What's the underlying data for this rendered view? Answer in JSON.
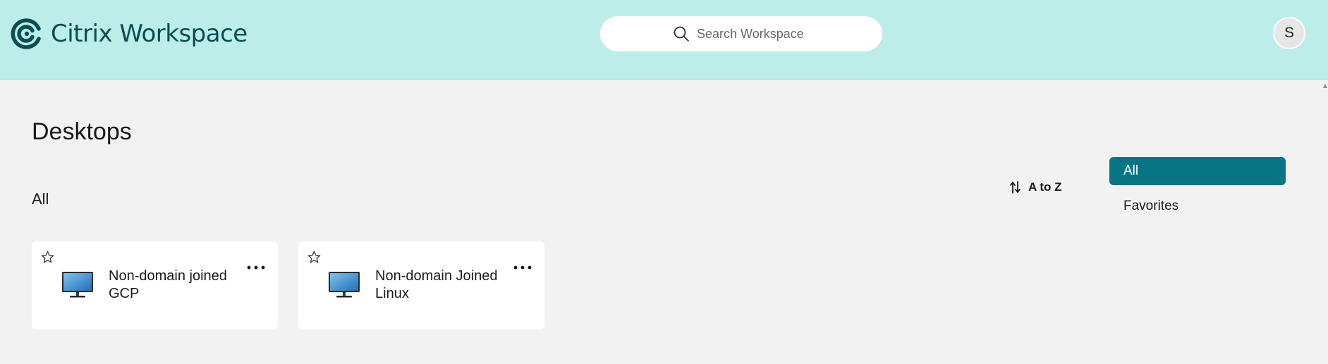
{
  "header": {
    "logo_text": "Citrix Workspace",
    "search": {
      "placeholder": "Search Workspace",
      "value": ""
    },
    "avatar_initial": "S",
    "background_color": "#bcede9",
    "brand_color": "#0a4d52"
  },
  "page": {
    "title": "Desktops",
    "section_label": "All",
    "sort_label": "A to Z",
    "sort_icon": "sort-arrows-icon",
    "accent_color": "#077584"
  },
  "filters": [
    {
      "label": "All",
      "active": true
    },
    {
      "label": "Favorites",
      "active": false
    }
  ],
  "desktops": [
    {
      "name": "Non-domain joined GCP",
      "icon": "desktop-monitor-icon",
      "favorite": false
    },
    {
      "name": "Non-domain Joined Linux",
      "icon": "desktop-monitor-icon",
      "favorite": false
    }
  ]
}
